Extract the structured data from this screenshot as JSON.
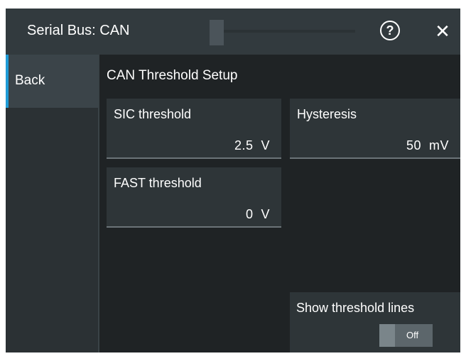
{
  "title": "Serial Bus: CAN",
  "titlebar": {
    "help_glyph": "?",
    "close_glyph": "✕"
  },
  "sidebar": {
    "back_label": "Back"
  },
  "section_title": "CAN Threshold Setup",
  "fields": {
    "sic_threshold": {
      "label": "SIC threshold",
      "value": "2.5  V"
    },
    "hysteresis": {
      "label": "Hysteresis",
      "value": "50  mV"
    },
    "fast_threshold": {
      "label": "FAST threshold",
      "value": "0  V"
    }
  },
  "show_threshold_lines": {
    "label": "Show threshold lines",
    "state": "Off"
  },
  "colors": {
    "accent": "#1e9bd7",
    "background": "#1f2325",
    "titlebar": "#323a3e"
  }
}
